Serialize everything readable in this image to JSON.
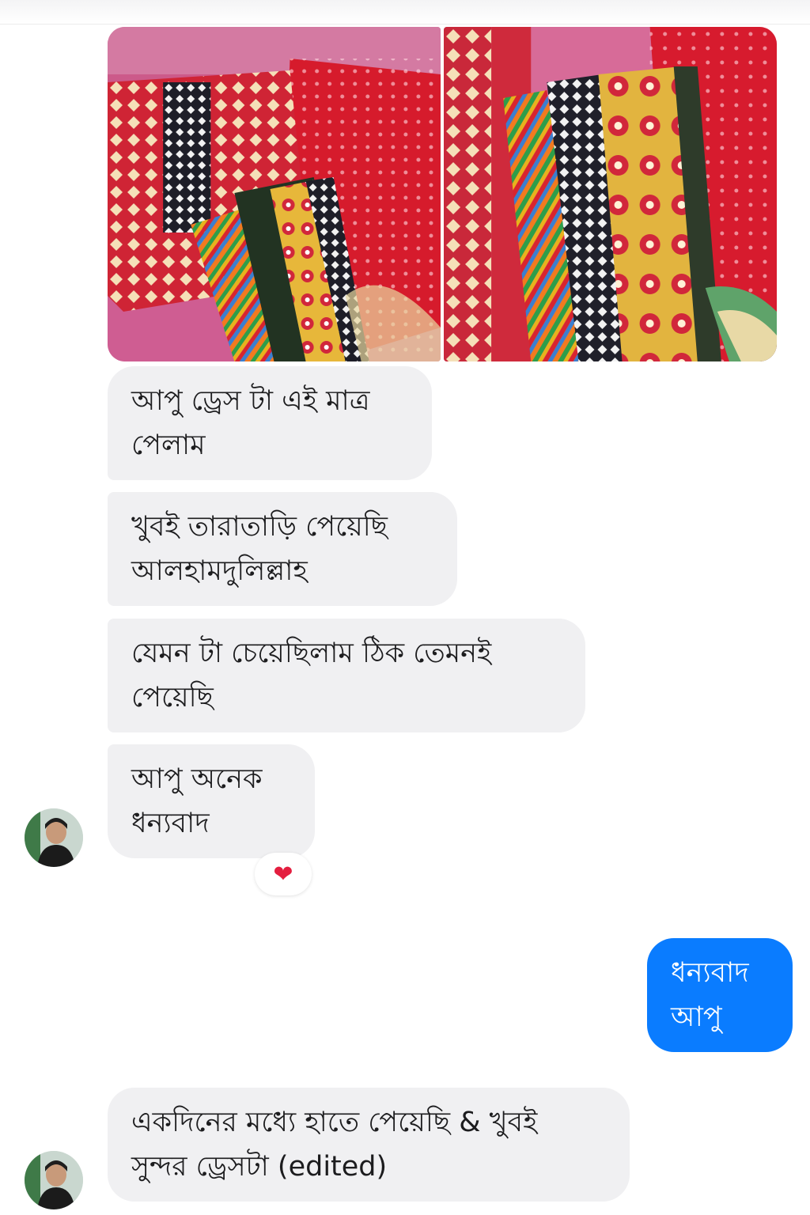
{
  "messages": {
    "incoming": [
      "আপু ড্রেস টা এই মাত্র\nপেলাম",
      "খুবই তারাতাড়ি পেয়েছি\nআলহামদুলিল্লাহ",
      "যেমন টা চেয়েছিলাম ঠিক তেমনই\nপেয়েছি",
      "আপু অনেক\nধন্যবাদ",
      "একদিনের মধ্যে হাতে পেয়েছি & খুবই\nসুন্দর ড্রেসটা (edited)"
    ],
    "outgoing": [
      "ধন্যবাদ\nআপু"
    ]
  },
  "reaction": {
    "emoji": "❤",
    "color": "#e41e3f"
  },
  "colors": {
    "incoming_bubble": "#f0f0f2",
    "outgoing_bubble": "#0a7cff",
    "outgoing_text": "#ffffff"
  },
  "photos": [
    "dress-photo-1",
    "dress-photo-2"
  ]
}
